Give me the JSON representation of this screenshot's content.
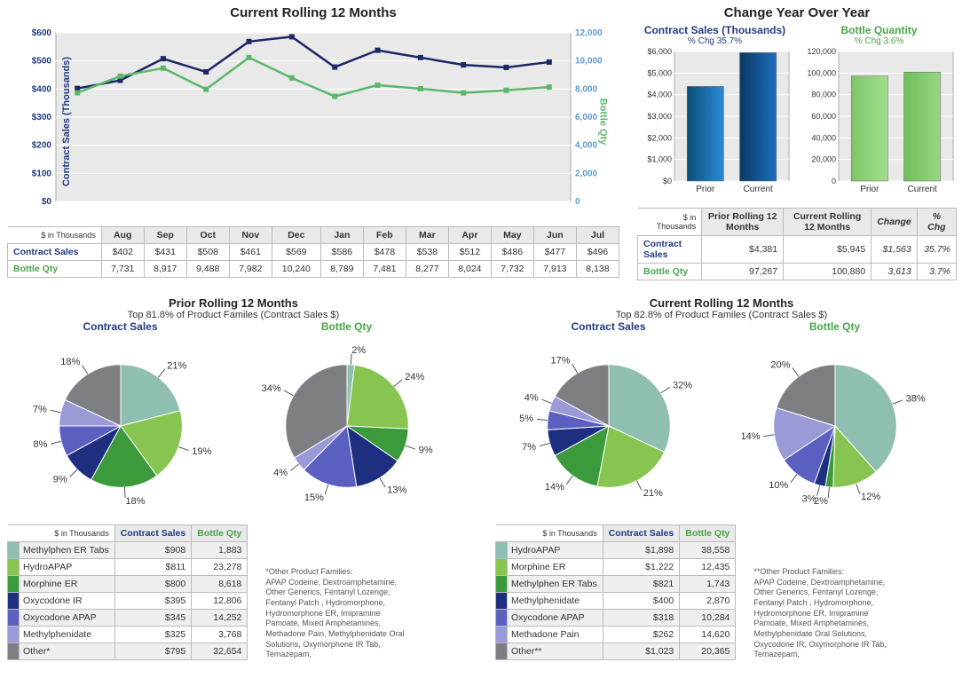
{
  "lineChart": {
    "title": "Current Rolling 12 Months",
    "leftAxisLabel": "Contract Sales (Thousands)",
    "rightAxisLabel": "Bottle Qty",
    "corner": "$ in Thousands",
    "rowCS": "Contract Sales",
    "rowBQ": "Bottle Qty",
    "months": [
      "Aug",
      "Sep",
      "Oct",
      "Nov",
      "Dec",
      "Jan",
      "Feb",
      "Mar",
      "Apr",
      "May",
      "Jun",
      "Jul"
    ],
    "contractSales": [
      402,
      431,
      508,
      461,
      569,
      586,
      478,
      538,
      512,
      486,
      477,
      496
    ],
    "contractSalesFmt": [
      "$402",
      "$431",
      "$508",
      "$461",
      "$569",
      "$586",
      "$478",
      "$538",
      "$512",
      "$486",
      "$477",
      "$496"
    ],
    "bottleQty": [
      7731,
      8917,
      9488,
      7982,
      10240,
      8789,
      7481,
      8277,
      8024,
      7732,
      7913,
      8138
    ],
    "bottleQtyFmt": [
      "7,731",
      "8,917",
      "9,488",
      "7,982",
      "10,240",
      "8,789",
      "7,481",
      "8,277",
      "8,024",
      "7,732",
      "7,913",
      "8,138"
    ],
    "leftTicks": [
      "$0",
      "$100",
      "$200",
      "$300",
      "$400",
      "$500",
      "$600"
    ],
    "rightTicks": [
      "0",
      "2,000",
      "4,000",
      "6,000",
      "8,000",
      "10,000",
      "12,000"
    ]
  },
  "yoy": {
    "title": "Change Year Over Year",
    "csTitle": "Contract Sales (Thousands)",
    "csChg": "% Chg 35.7%",
    "bqTitle": "Bottle Quantity",
    "bqChg": "% Chg 3.6%",
    "csTicks": [
      "$0",
      "$1,000",
      "$2,000",
      "$3,000",
      "$4,000",
      "$5,000",
      "$6,000"
    ],
    "bqTicks": [
      "0",
      "20,000",
      "40,000",
      "60,000",
      "80,000",
      "100,000",
      "120,000"
    ],
    "catLabels": [
      "Prior",
      "Current"
    ],
    "csValues": [
      4381,
      5945
    ],
    "bqValues": [
      97267,
      100880
    ],
    "table": {
      "corner": "$ in Thousands",
      "headers": [
        "Prior Rolling 12 Months",
        "Current Rolling 12 Months",
        "Change",
        "% Chg"
      ],
      "csLabel": "Contract Sales",
      "bqLabel": "Bottle Qty",
      "csRow": [
        "$4,381",
        "$5,945",
        "$1,563",
        "35.7%"
      ],
      "bqRow": [
        "97,267",
        "100,880",
        "3,613",
        "3.7%"
      ]
    }
  },
  "prior": {
    "title": "Prior Rolling 12 Months",
    "subtitle": "Top 81.8% of Product Familes (Contract Sales $)",
    "csLabel": "Contract Sales",
    "bqLabel": "Bottle Qty",
    "csSlices": [
      {
        "label": "21%",
        "v": 21,
        "color": "#8fbfb0"
      },
      {
        "label": "19%",
        "v": 19,
        "color": "#87c550"
      },
      {
        "label": "18%",
        "v": 18,
        "color": "#3b9a3b"
      },
      {
        "label": "9%",
        "v": 9,
        "color": "#1f2f80"
      },
      {
        "label": "8%",
        "v": 8,
        "color": "#5a5fc0"
      },
      {
        "label": "7%",
        "v": 7,
        "color": "#9a9ad6"
      },
      {
        "label": "18%",
        "v": 18,
        "color": "#7d7f83"
      }
    ],
    "bqSlices": [
      {
        "label": "2%",
        "v": 2,
        "color": "#8fbfb0"
      },
      {
        "label": "24%",
        "v": 24,
        "color": "#87c550"
      },
      {
        "label": "9%",
        "v": 9,
        "color": "#3b9a3b"
      },
      {
        "label": "13%",
        "v": 13,
        "color": "#1f2f80"
      },
      {
        "label": "15%",
        "v": 15,
        "color": "#5a5fc0"
      },
      {
        "label": "4%",
        "v": 4,
        "color": "#9a9ad6"
      },
      {
        "label": "34%",
        "v": 34,
        "color": "#7d7f83"
      }
    ],
    "tableCorner": "$ in Thousands",
    "tableHeaders": [
      "Contract Sales",
      "Bottle Qty"
    ],
    "rows": [
      {
        "color": "#8fbfb0",
        "name": "Methylphen ER Tabs",
        "cs": "$908",
        "bq": "1,883"
      },
      {
        "color": "#87c550",
        "name": "HydroAPAP",
        "cs": "$811",
        "bq": "23,278"
      },
      {
        "color": "#3b9a3b",
        "name": "Morphine ER",
        "cs": "$800",
        "bq": "8,618"
      },
      {
        "color": "#1f2f80",
        "name": "Oxycodone IR",
        "cs": "$395",
        "bq": "12,806"
      },
      {
        "color": "#5a5fc0",
        "name": "Oxycodone APAP",
        "cs": "$345",
        "bq": "14,252"
      },
      {
        "color": "#9a9ad6",
        "name": "Methylphenidate",
        "cs": "$325",
        "bq": "3,768"
      },
      {
        "color": "#7d7f83",
        "name": "Other*",
        "cs": "$795",
        "bq": "32,654"
      }
    ],
    "footnote": "*Other Product Families:\nAPAP Codeine, Dextroamphetamine, Other Generics, Fentanyl Lozenge, Fentanyl Patch , Hydromorphone, Hydromorphone ER, Imipramine Pamoate, Mixed Amphetamines, Methadone Pain, Methylphenidate Oral Solutions, Oxymorphone IR Tab, Temazepam,"
  },
  "current": {
    "title": "Current Rolling 12 Months",
    "subtitle": "Top 82.8% of Product Familes (Contract Sales $)",
    "csLabel": "Contract Sales",
    "bqLabel": "Bottle Qty",
    "csSlices": [
      {
        "label": "32%",
        "v": 32,
        "color": "#8fbfb0"
      },
      {
        "label": "21%",
        "v": 21,
        "color": "#87c550"
      },
      {
        "label": "14%",
        "v": 14,
        "color": "#3b9a3b"
      },
      {
        "label": "7%",
        "v": 7,
        "color": "#1f2f80"
      },
      {
        "label": "5%",
        "v": 5,
        "color": "#5a5fc0"
      },
      {
        "label": "4%",
        "v": 4,
        "color": "#9a9ad6"
      },
      {
        "label": "17%",
        "v": 17,
        "color": "#7d7f83"
      }
    ],
    "bqSlices": [
      {
        "label": "38%",
        "v": 38,
        "color": "#8fbfb0"
      },
      {
        "label": "12%",
        "v": 12,
        "color": "#87c550"
      },
      {
        "label": "2%",
        "v": 2,
        "color": "#3b9a3b"
      },
      {
        "label": "3%",
        "v": 3,
        "color": "#1f2f80"
      },
      {
        "label": "10%",
        "v": 10,
        "color": "#5a5fc0"
      },
      {
        "label": "14%",
        "v": 14,
        "color": "#9a9ad6"
      },
      {
        "label": "20%",
        "v": 20,
        "color": "#7d7f83"
      }
    ],
    "tableCorner": "$ in Thousands",
    "tableHeaders": [
      "Contract Sales",
      "Bottle Qty"
    ],
    "rows": [
      {
        "color": "#8fbfb0",
        "name": "HydroAPAP",
        "cs": "$1,898",
        "bq": "38,558"
      },
      {
        "color": "#87c550",
        "name": "Morphine ER",
        "cs": "$1,222",
        "bq": "12,435"
      },
      {
        "color": "#3b9a3b",
        "name": "Methylphen ER Tabs",
        "cs": "$821",
        "bq": "1,743"
      },
      {
        "color": "#1f2f80",
        "name": "Methylphenidate",
        "cs": "$400",
        "bq": "2,870"
      },
      {
        "color": "#5a5fc0",
        "name": "Oxycodone APAP",
        "cs": "$318",
        "bq": "10,284"
      },
      {
        "color": "#9a9ad6",
        "name": "Methadone Pain",
        "cs": "$262",
        "bq": "14,620"
      },
      {
        "color": "#7d7f83",
        "name": "Other**",
        "cs": "$1,023",
        "bq": "20,365"
      }
    ],
    "footnote": "**Other Product Families:\nAPAP Codeine, Dextroamphetamine, Other Generics, Fentanyl Lozenge, Fentanyl Patch , Hydromorphone, Hydromorphone ER, Imipramine Pamoate, Mixed Amphetamines, Methylphenidate Oral Solutions, Oxycodone IR, Oxymorphone IR Tab, Temazepam,"
  },
  "chart_data": [
    {
      "type": "line",
      "title": "Current Rolling 12 Months",
      "x": [
        "Aug",
        "Sep",
        "Oct",
        "Nov",
        "Dec",
        "Jan",
        "Feb",
        "Mar",
        "Apr",
        "May",
        "Jun",
        "Jul"
      ],
      "series": [
        {
          "name": "Contract Sales (Thousands)",
          "values": [
            402,
            431,
            508,
            461,
            569,
            586,
            478,
            538,
            512,
            486,
            477,
            496
          ],
          "axis": "left"
        },
        {
          "name": "Bottle Qty",
          "values": [
            7731,
            8917,
            9488,
            7982,
            10240,
            8789,
            7481,
            8277,
            8024,
            7732,
            7913,
            8138
          ],
          "axis": "right"
        }
      ],
      "ylim_left": [
        0,
        600
      ],
      "ylim_right": [
        0,
        12000
      ]
    },
    {
      "type": "bar",
      "title": "Change Year Over Year - Contract Sales (Thousands)",
      "categories": [
        "Prior",
        "Current"
      ],
      "values": [
        4381,
        5945
      ],
      "ylim": [
        0,
        6000
      ],
      "pct_change": 35.7
    },
    {
      "type": "bar",
      "title": "Change Year Over Year - Bottle Quantity",
      "categories": [
        "Prior",
        "Current"
      ],
      "values": [
        97267,
        100880
      ],
      "ylim": [
        0,
        120000
      ],
      "pct_change": 3.6
    },
    {
      "type": "pie",
      "title": "Prior Rolling 12 Months - Contract Sales",
      "slices": [
        {
          "name": "Methylphen ER Tabs",
          "pct": 21
        },
        {
          "name": "HydroAPAP",
          "pct": 19
        },
        {
          "name": "Morphine ER",
          "pct": 18
        },
        {
          "name": "Oxycodone IR",
          "pct": 9
        },
        {
          "name": "Oxycodone APAP",
          "pct": 8
        },
        {
          "name": "Methylphenidate",
          "pct": 7
        },
        {
          "name": "Other",
          "pct": 18
        }
      ]
    },
    {
      "type": "pie",
      "title": "Prior Rolling 12 Months - Bottle Qty",
      "slices": [
        {
          "name": "Methylphen ER Tabs",
          "pct": 2
        },
        {
          "name": "HydroAPAP",
          "pct": 24
        },
        {
          "name": "Morphine ER",
          "pct": 9
        },
        {
          "name": "Oxycodone IR",
          "pct": 13
        },
        {
          "name": "Oxycodone APAP",
          "pct": 15
        },
        {
          "name": "Methylphenidate",
          "pct": 4
        },
        {
          "name": "Other",
          "pct": 34
        }
      ]
    },
    {
      "type": "pie",
      "title": "Current Rolling 12 Months - Contract Sales",
      "slices": [
        {
          "name": "HydroAPAP",
          "pct": 32
        },
        {
          "name": "Morphine ER",
          "pct": 21
        },
        {
          "name": "Methylphen ER Tabs",
          "pct": 14
        },
        {
          "name": "Methylphenidate",
          "pct": 7
        },
        {
          "name": "Oxycodone APAP",
          "pct": 5
        },
        {
          "name": "Methadone Pain",
          "pct": 4
        },
        {
          "name": "Other",
          "pct": 17
        }
      ]
    },
    {
      "type": "pie",
      "title": "Current Rolling 12 Months - Bottle Qty",
      "slices": [
        {
          "name": "HydroAPAP",
          "pct": 38
        },
        {
          "name": "Morphine ER",
          "pct": 12
        },
        {
          "name": "Methylphen ER Tabs",
          "pct": 2
        },
        {
          "name": "Methylphenidate",
          "pct": 3
        },
        {
          "name": "Oxycodone APAP",
          "pct": 10
        },
        {
          "name": "Methadone Pain",
          "pct": 14
        },
        {
          "name": "Other",
          "pct": 20
        }
      ]
    }
  ]
}
